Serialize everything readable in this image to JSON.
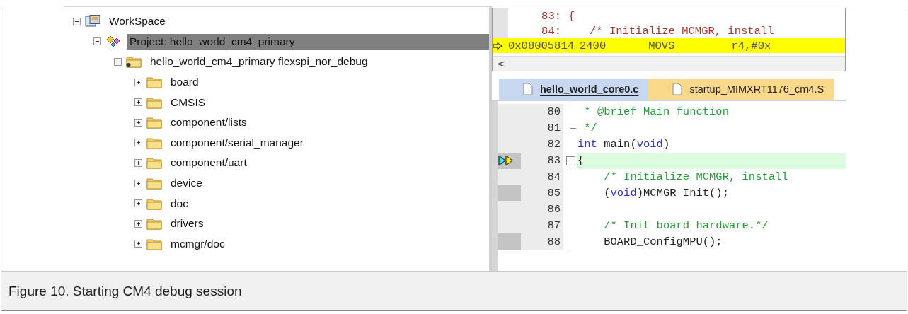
{
  "tree": [
    {
      "label": "WorkSpace",
      "kind": "workspace",
      "expanded": true,
      "selected": false,
      "children": [
        {
          "label": "Project: hello_world_cm4_primary",
          "kind": "project",
          "expanded": true,
          "selected": true,
          "children": [
            {
              "label": "hello_world_cm4_primary flexspi_nor_debug",
              "kind": "configuration",
              "expanded": true,
              "selected": false,
              "children": [
                {
                  "label": "board",
                  "kind": "folder",
                  "expanded": false,
                  "selected": false
                },
                {
                  "label": "CMSIS",
                  "kind": "folder",
                  "expanded": false,
                  "selected": false
                },
                {
                  "label": "component/lists",
                  "kind": "folder",
                  "expanded": false,
                  "selected": false
                },
                {
                  "label": "component/serial_manager",
                  "kind": "folder",
                  "expanded": false,
                  "selected": false
                },
                {
                  "label": "component/uart",
                  "kind": "folder",
                  "expanded": false,
                  "selected": false
                },
                {
                  "label": "device",
                  "kind": "folder",
                  "expanded": false,
                  "selected": false
                },
                {
                  "label": "doc",
                  "kind": "folder",
                  "expanded": false,
                  "selected": false
                },
                {
                  "label": "drivers",
                  "kind": "folder",
                  "expanded": false,
                  "selected": false
                },
                {
                  "label": "mcmgr/doc",
                  "kind": "folder",
                  "expanded": false,
                  "selected": false
                }
              ]
            }
          ]
        }
      ]
    }
  ],
  "disassembly": {
    "lines": [
      {
        "kind": "source",
        "line": "83:",
        "code": "{",
        "current": false
      },
      {
        "kind": "source",
        "line": "84:",
        "code": "/* Initialize MCMGR, install",
        "current": false
      },
      {
        "kind": "instruction",
        "address": "0x08005814",
        "opcode": "2400",
        "mnemonic": "MOVS",
        "operands": "r4,#0x",
        "current": true
      }
    ],
    "scroll_left": "<"
  },
  "tabs": [
    {
      "label": "hello_world_core0.c",
      "selected": true
    },
    {
      "label": "startup_MIMXRT1176_cm4.S",
      "selected": false
    }
  ],
  "editor": {
    "lines": [
      {
        "number": "80",
        "kind": "foldbody",
        "tokens": [
          {
            "kind": "comment",
            "text": " * @brief Main function"
          }
        ],
        "current": false,
        "executable": false
      },
      {
        "number": "81",
        "kind": "foldend",
        "tokens": [
          {
            "kind": "comment",
            "text": " */"
          }
        ],
        "current": false,
        "executable": false
      },
      {
        "number": "82",
        "kind": "plain",
        "tokens": [
          {
            "kind": "keyword",
            "text": "int"
          },
          {
            "kind": "plain",
            "text": " main("
          },
          {
            "kind": "keyword",
            "text": "void"
          },
          {
            "kind": "plain",
            "text": ")"
          }
        ],
        "current": false,
        "executable": false
      },
      {
        "number": "83",
        "kind": "foldstart",
        "tokens": [
          {
            "kind": "plain",
            "text": "{"
          }
        ],
        "current": true,
        "executable": false
      },
      {
        "number": "84",
        "kind": "foldbody",
        "tokens": [
          {
            "kind": "comment",
            "text": "    /* Initialize MCMGR, install"
          }
        ],
        "current": false,
        "executable": false
      },
      {
        "number": "85",
        "kind": "foldbody",
        "tokens": [
          {
            "kind": "plain",
            "text": "    ("
          },
          {
            "kind": "keyword",
            "text": "void"
          },
          {
            "kind": "plain",
            "text": ")MCMGR_Init();"
          }
        ],
        "current": false,
        "executable": true
      },
      {
        "number": "86",
        "kind": "foldbody",
        "current": false,
        "executable": false
      },
      {
        "number": "87",
        "kind": "foldbody",
        "tokens": [
          {
            "kind": "comment",
            "text": "    /* Init board hardware.*/"
          }
        ],
        "current": false,
        "executable": false
      },
      {
        "number": "88",
        "kind": "foldbody",
        "tokens": [
          {
            "kind": "plain",
            "text": "    BOARD_ConfigMPU();"
          }
        ],
        "current": false,
        "executable": true
      }
    ]
  },
  "caption": "Figure 10. Starting CM4 debug session"
}
